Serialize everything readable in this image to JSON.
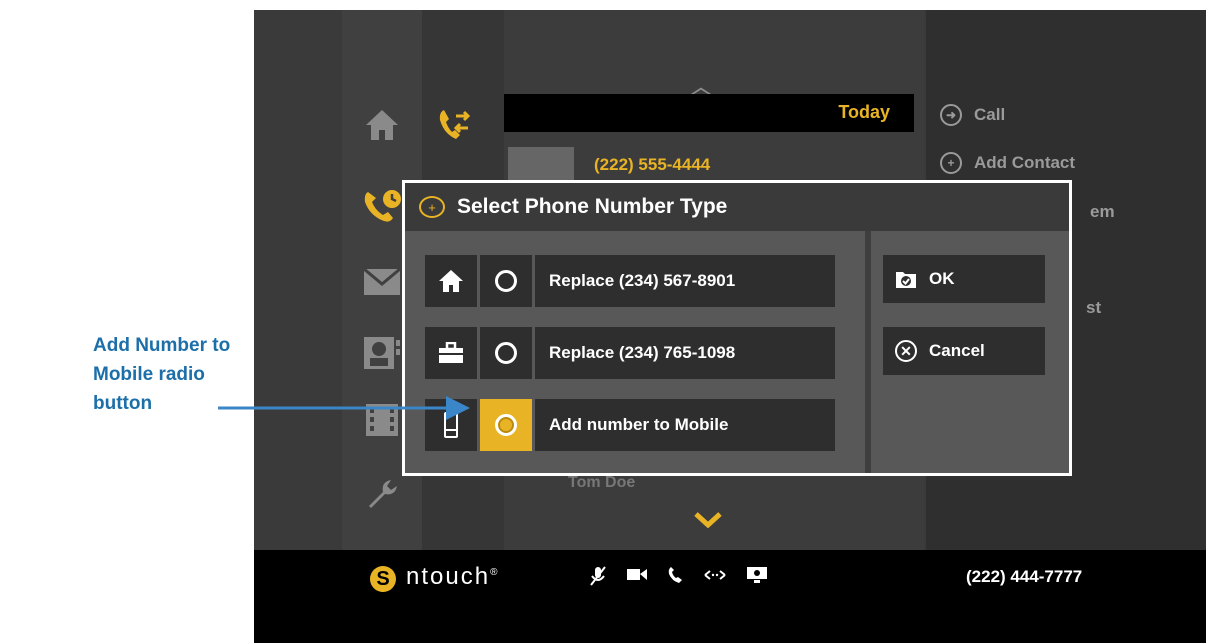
{
  "callout": {
    "line1": "Add Number to",
    "line2": "Mobile radio",
    "line3": "button",
    "color": "#1c6fa8"
  },
  "call_history": {
    "group_label": "Today",
    "entry_number": "(222) 555-4444",
    "partial_entry": "Tom Doe"
  },
  "actions_panel": {
    "call": "Call",
    "add_contact": "Add Contact",
    "partial_item_1": "em",
    "partial_item_2": "st"
  },
  "dialog": {
    "title": "Select Phone Number Type",
    "options": [
      {
        "icon": "home-icon",
        "label": "Replace (234) 567-8901",
        "selected": false
      },
      {
        "icon": "briefcase-icon",
        "label": "Replace (234) 765-1098",
        "selected": false
      },
      {
        "icon": "mobile-phone-icon",
        "label": "Add number to Mobile",
        "selected": true
      }
    ],
    "ok_label": "OK",
    "cancel_label": "Cancel"
  },
  "status_bar": {
    "brand": "ntouch",
    "registered": "®",
    "my_number": "(222) 444-7777"
  },
  "colors": {
    "accent": "#e8b324",
    "dialog_border": "#ffffff",
    "background": "#3a3a3a"
  }
}
